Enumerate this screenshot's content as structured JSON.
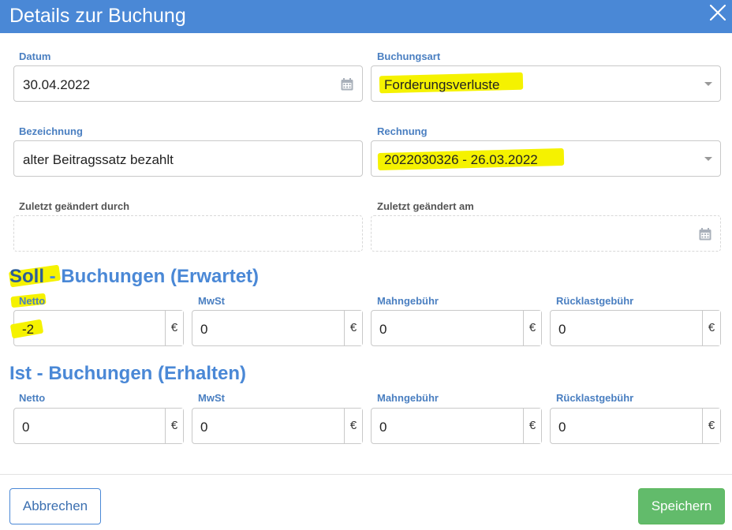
{
  "dialog": {
    "title": "Details zur Buchung"
  },
  "fields": {
    "datum": {
      "label": "Datum",
      "value": "30.04.2022"
    },
    "buchungsart": {
      "label": "Buchungsart",
      "value": "Forderungsverluste"
    },
    "bezeichnung": {
      "label": "Bezeichnung",
      "value": "alter Beitragssatz bezahlt"
    },
    "rechnung": {
      "label": "Rechnung",
      "value": "2022030326 - 26.03.2022"
    },
    "zuletzt_durch": {
      "label": "Zuletzt geändert durch",
      "value": ""
    },
    "zuletzt_am": {
      "label": "Zuletzt geändert am",
      "value": ""
    }
  },
  "soll": {
    "title_part1": "Soll",
    "title_part2": " - Buchungen (Erwartet)",
    "netto": {
      "label": "Netto",
      "value": "-2",
      "currency": "€"
    },
    "mwst": {
      "label": "MwSt",
      "value": "0",
      "currency": "€"
    },
    "mahngebuehr": {
      "label": "Mahngebühr",
      "value": "0",
      "currency": "€"
    },
    "ruecklastgebuehr": {
      "label": "Rücklastgebühr",
      "value": "0",
      "currency": "€"
    }
  },
  "ist": {
    "title": "Ist - Buchungen (Erhalten)",
    "netto": {
      "label": "Netto",
      "value": "0",
      "currency": "€"
    },
    "mwst": {
      "label": "MwSt",
      "value": "0",
      "currency": "€"
    },
    "mahngebuehr": {
      "label": "Mahngebühr",
      "value": "0",
      "currency": "€"
    },
    "ruecklastgebuehr": {
      "label": "Rücklastgebühr",
      "value": "0",
      "currency": "€"
    }
  },
  "buttons": {
    "cancel": "Abbrechen",
    "save": "Speichern"
  },
  "colors": {
    "header": "#4a88d6",
    "label": "#4a7fc1",
    "highlight": "#f5f200",
    "save": "#62bb6b"
  },
  "icons": {
    "close": "close-icon",
    "calendar": "calendar-icon",
    "dropdown": "chevron-down-icon"
  }
}
